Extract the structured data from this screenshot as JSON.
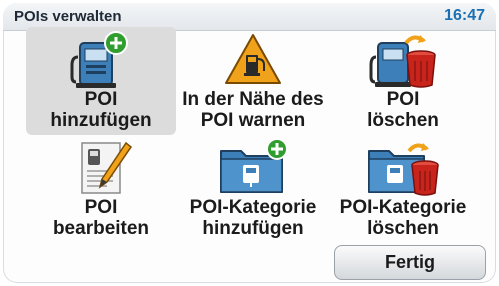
{
  "header": {
    "title": "POIs verwalten",
    "time": "16:47"
  },
  "tiles": [
    {
      "line1": "POI",
      "line2": "hinzufügen",
      "icon": "gas-pump-plus-icon"
    },
    {
      "line1": "In der Nähe des",
      "line2": "POI warnen",
      "icon": "warning-gas-icon"
    },
    {
      "line1": "POI",
      "line2": "löschen",
      "icon": "gas-pump-trash-icon"
    },
    {
      "line1": "POI",
      "line2": "bearbeiten",
      "icon": "gas-note-pencil-icon"
    },
    {
      "line1": "POI-Kategorie",
      "line2": "hinzufügen",
      "icon": "folder-plus-icon"
    },
    {
      "line1": "POI-Kategorie",
      "line2": "löschen",
      "icon": "folder-trash-icon"
    }
  ],
  "footer": {
    "done_label": "Fertig"
  },
  "colors": {
    "accent": "#1b6fb3",
    "add_green": "#2f9e2f",
    "trash_red": "#c9241c"
  }
}
